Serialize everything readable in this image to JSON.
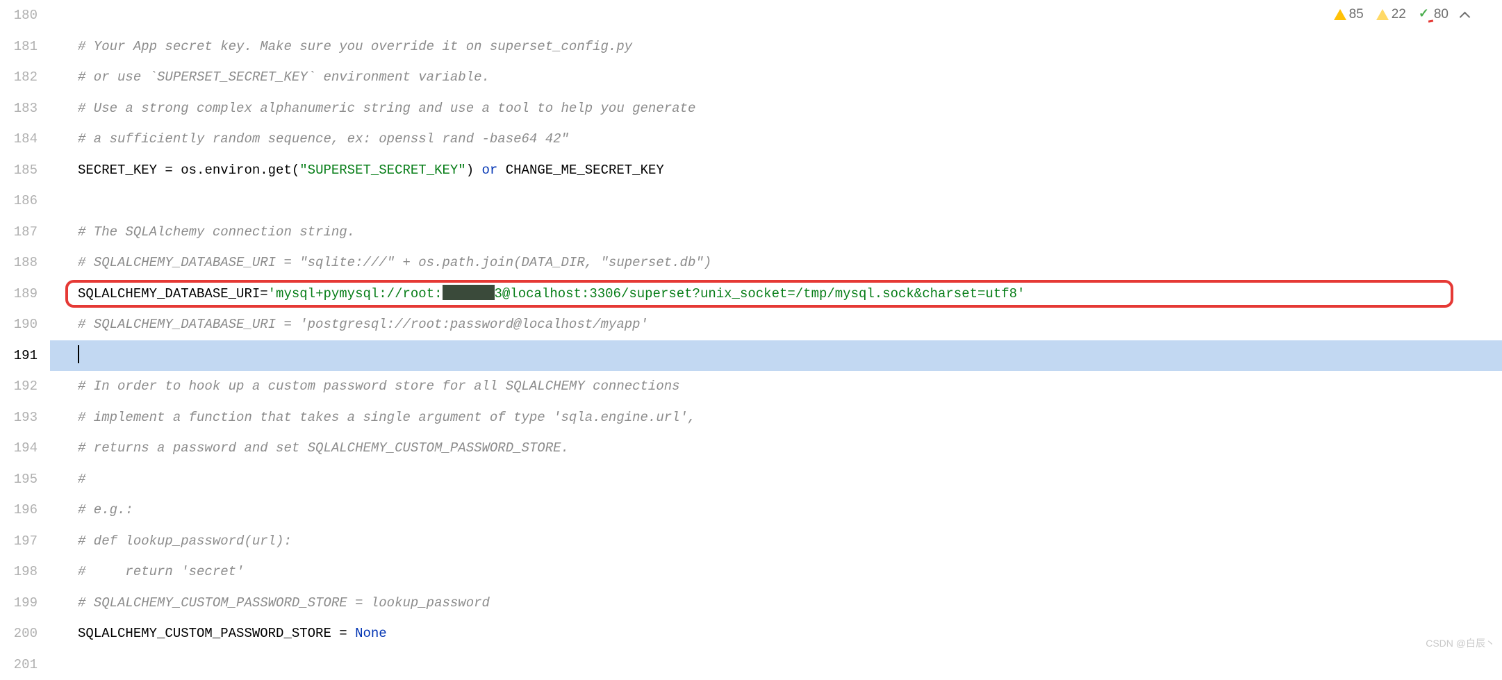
{
  "inspections": {
    "warning_strong": 85,
    "warning_weak": 22,
    "typo": 80
  },
  "watermark": "CSDN @白辰丶",
  "gutter": {
    "start": 180,
    "end": 201,
    "current": 191
  },
  "lines": {
    "180": {
      "type": "blank"
    },
    "181": {
      "type": "comment",
      "text": "# Your App secret key. Make sure you override it on superset_config.py"
    },
    "182": {
      "type": "comment",
      "text": "# or use `SUPERSET_SECRET_KEY` environment variable."
    },
    "183": {
      "type": "comment",
      "text": "# Use a strong complex alphanumeric string and use a tool to help you generate"
    },
    "184": {
      "type": "comment",
      "text": "# a sufficiently random sequence, ex: openssl rand -base64 42\""
    },
    "185": {
      "type": "code",
      "tokens": [
        {
          "cls": "identifier",
          "t": "SECRET_KEY "
        },
        {
          "cls": "identifier",
          "t": "= "
        },
        {
          "cls": "identifier",
          "t": "os.environ.get("
        },
        {
          "cls": "string",
          "t": "\"SUPERSET_SECRET_KEY\""
        },
        {
          "cls": "identifier",
          "t": ") "
        },
        {
          "cls": "keyword",
          "t": "or"
        },
        {
          "cls": "identifier",
          "t": " CHANGE_ME_SECRET_KEY"
        }
      ]
    },
    "186": {
      "type": "blank"
    },
    "187": {
      "type": "comment",
      "text": "# The SQLAlchemy connection string."
    },
    "188": {
      "type": "comment",
      "text": "# SQLALCHEMY_DATABASE_URI = \"sqlite:///\" + os.path.join(DATA_DIR, \"superset.db\")"
    },
    "189": {
      "type": "code",
      "marked": true,
      "tokens": [
        {
          "cls": "identifier",
          "t": "SQLALCHEMY_DATABASE_URI"
        },
        {
          "cls": "identifier",
          "t": "="
        },
        {
          "cls": "string",
          "t": "'mysql+pymysql://root:"
        },
        {
          "cls": "redacted",
          "t": ""
        },
        {
          "cls": "string",
          "t": "3@localhost:3306/superset?unix_socket=/tmp/mysql.sock&charset=utf8'"
        }
      ]
    },
    "190": {
      "type": "comment",
      "text": "# SQLALCHEMY_DATABASE_URI = 'postgresql://root:password@localhost/myapp'"
    },
    "191": {
      "type": "current"
    },
    "192": {
      "type": "comment",
      "text": "# In order to hook up a custom password store for all SQLALCHEMY connections"
    },
    "193": {
      "type": "comment",
      "text": "# implement a function that takes a single argument of type 'sqla.engine.url',"
    },
    "194": {
      "type": "comment",
      "text": "# returns a password and set SQLALCHEMY_CUSTOM_PASSWORD_STORE."
    },
    "195": {
      "type": "comment",
      "text": "#"
    },
    "196": {
      "type": "comment",
      "text": "# e.g.:"
    },
    "197": {
      "type": "comment",
      "text": "# def lookup_password(url):"
    },
    "198": {
      "type": "comment",
      "text": "#     return 'secret'"
    },
    "199": {
      "type": "comment",
      "text": "# SQLALCHEMY_CUSTOM_PASSWORD_STORE = lookup_password"
    },
    "200": {
      "type": "code",
      "tokens": [
        {
          "cls": "identifier",
          "t": "SQLALCHEMY_CUSTOM_PASSWORD_STORE = "
        },
        {
          "cls": "constant",
          "t": "None"
        }
      ]
    },
    "201": {
      "type": "blank"
    }
  }
}
